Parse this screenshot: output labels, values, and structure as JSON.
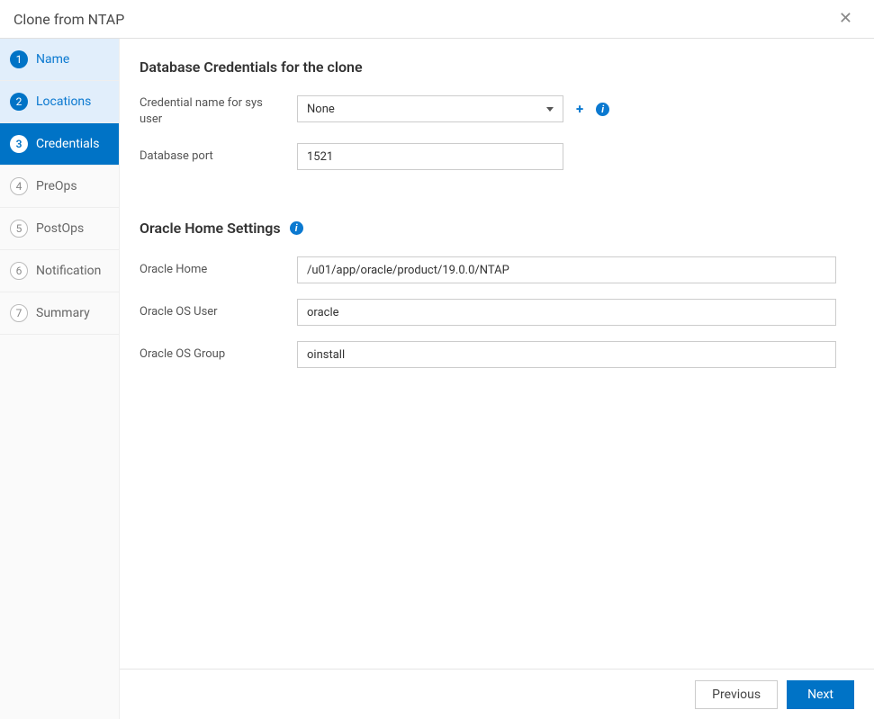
{
  "header": {
    "title": "Clone from NTAP"
  },
  "sidebar": {
    "steps": [
      {
        "num": "1",
        "label": "Name",
        "state": "completed"
      },
      {
        "num": "2",
        "label": "Locations",
        "state": "completed"
      },
      {
        "num": "3",
        "label": "Credentials",
        "state": "active"
      },
      {
        "num": "4",
        "label": "PreOps",
        "state": "future"
      },
      {
        "num": "5",
        "label": "PostOps",
        "state": "future"
      },
      {
        "num": "6",
        "label": "Notification",
        "state": "future"
      },
      {
        "num": "7",
        "label": "Summary",
        "state": "future"
      }
    ]
  },
  "sections": {
    "credentials": {
      "title": "Database Credentials for the clone",
      "credential_label": "Credential name for sys user",
      "credential_value": "None",
      "port_label": "Database port",
      "port_value": "1521"
    },
    "oracle_home": {
      "title": "Oracle Home Settings",
      "home_label": "Oracle Home",
      "home_value": "/u01/app/oracle/product/19.0.0/NTAP",
      "os_user_label": "Oracle OS User",
      "os_user_value": "oracle",
      "os_group_label": "Oracle OS Group",
      "os_group_value": "oinstall"
    }
  },
  "footer": {
    "previous": "Previous",
    "next": "Next"
  }
}
